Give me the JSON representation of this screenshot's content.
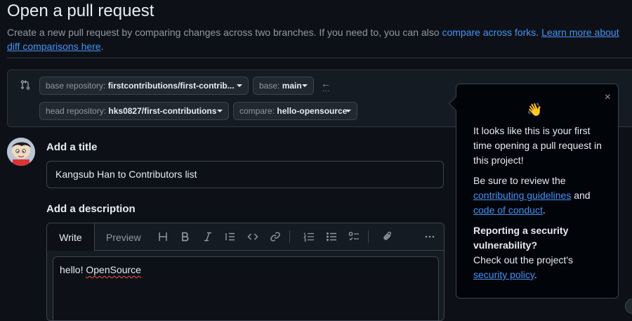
{
  "header": {
    "title": "Open a pull request",
    "subtitle_text": "Create a new pull request by comparing changes across two branches. If you need to, you can also",
    "compare_forks_link": "compare across forks",
    "learn_more_link": "Learn more about diff comparisons here"
  },
  "compare": {
    "base_repo_label": "base repository:",
    "base_repo_value": "firstcontributions/first-contrib...",
    "base_label": "base:",
    "base_value": "main",
    "head_repo_label": "head repository:",
    "head_repo_value": "hks0827/first-contributions",
    "compare_label": "compare:",
    "compare_value": "hello-opensource",
    "arrow": "←",
    "arrow_dots": "..."
  },
  "form": {
    "title_heading": "Add a title",
    "title_value": "Kangsub Han to Contributors list",
    "description_heading": "Add a description",
    "tab_write": "Write",
    "tab_preview": "Preview",
    "description_plain": "hello! ",
    "description_spell": "OpenSource"
  },
  "toolbar_icons": [
    "heading-icon",
    "bold-icon",
    "italic-icon",
    "quote-icon",
    "code-icon",
    "link-icon",
    "ordered-list-icon",
    "unordered-list-icon",
    "task-list-icon",
    "attach-icon",
    "more-icon"
  ],
  "popover": {
    "close": "×",
    "wave": "👋",
    "intro": "It looks like this is your first time opening a pull request in this project!",
    "review_prefix": "Be sure to review the",
    "guidelines_link": "contributing guidelines",
    "and": "and",
    "conduct_link": "code of conduct",
    "period": ".",
    "security_heading": "Reporting a security vulnerability?",
    "security_prefix": "Check out the project's",
    "security_link": "security policy",
    "security_suffix": "."
  },
  "colors": {
    "background": "#0d1117",
    "link": "#4493f8",
    "muted": "#9198a1",
    "border": "#3d444d"
  }
}
